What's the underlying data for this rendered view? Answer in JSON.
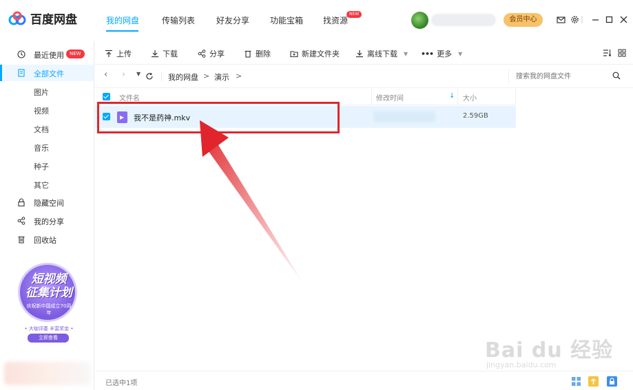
{
  "app": {
    "name": "百度网盘"
  },
  "nav": {
    "tabs": [
      "我的网盘",
      "传输列表",
      "好友分享",
      "功能宝箱",
      "找资源"
    ],
    "new_badge": "NEW",
    "vip_label": "会员中心"
  },
  "sidebar": {
    "items": [
      {
        "label": "最近使用",
        "badge": "NEW"
      },
      {
        "label": "全部文件"
      },
      {
        "label": "图片"
      },
      {
        "label": "视频"
      },
      {
        "label": "文档"
      },
      {
        "label": "音乐"
      },
      {
        "label": "种子"
      },
      {
        "label": "其它"
      },
      {
        "label": "隐藏空间"
      },
      {
        "label": "我的分享"
      },
      {
        "label": "回收站"
      }
    ],
    "promo": {
      "title_line1": "短视频",
      "title_line2": "征集计划",
      "subtitle": "庆祝新中国成立70周年",
      "line": "• 大咖评委 丰富奖金 •",
      "button": "立即查看"
    }
  },
  "toolbar": {
    "upload": "上传",
    "download": "下载",
    "share": "分享",
    "delete": "删除",
    "new_folder": "新建文件夹",
    "offline_download": "离线下载",
    "more": "更多"
  },
  "path": {
    "crumbs": [
      "我的网盘",
      "演示"
    ],
    "separator": ">",
    "search_placeholder": "搜索我的网盘文件"
  },
  "table": {
    "headers": {
      "name": "文件名",
      "modified": "修改时间",
      "size": "大小"
    },
    "rows": [
      {
        "name": "我不是药神.mkv",
        "size": "2.59GB",
        "selected": true
      }
    ]
  },
  "status": {
    "text": "已选中1项"
  },
  "watermark": {
    "main": "Bai du 经验",
    "sub": "jingyan.baidu.com"
  },
  "colors": {
    "accent": "#06a7ff",
    "highlight": "#e0262c",
    "badge": "#f5373e"
  }
}
